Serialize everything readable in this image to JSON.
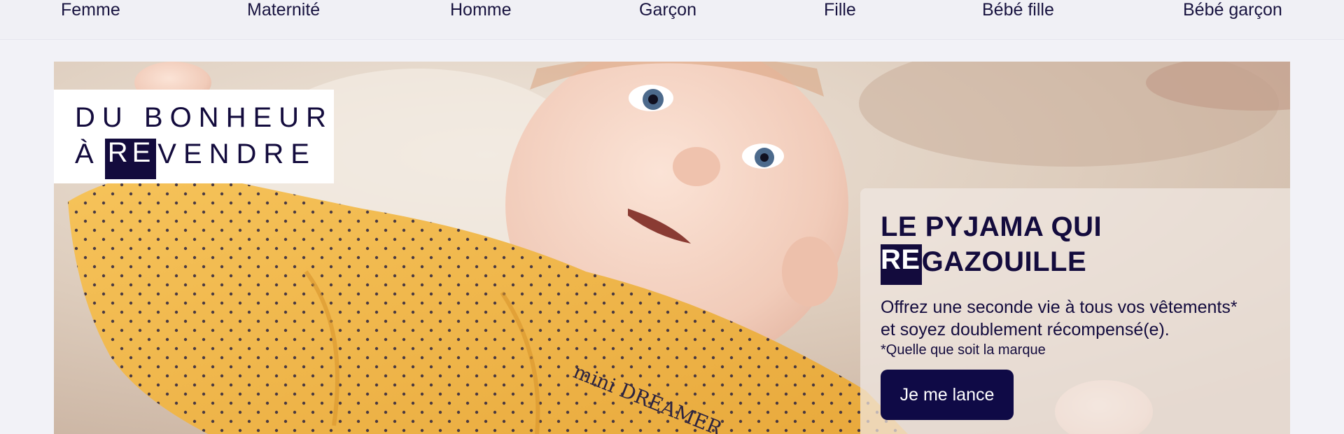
{
  "nav": {
    "items": [
      "Femme",
      "Maternité",
      "Homme",
      "Garçon",
      "Fille",
      "Bébé fille",
      "Bébé garçon"
    ]
  },
  "hero": {
    "logo": {
      "line1": "DU BONHEUR",
      "line2_prefix": "À",
      "line2_highlight": "RE",
      "line2_suffix": "VENDRE"
    },
    "promo": {
      "title_line1": "LE PYJAMA QUI",
      "title_highlight": "RE",
      "title_line2_rest": "GAZOUILLE",
      "description_line1": "Offrez une seconde vie à tous vos vêtements*",
      "description_line2": "et soyez doublement récompensé(e).",
      "footnote": "*Quelle que soit la marque",
      "cta_label": "Je me lance"
    },
    "image": {
      "garment_print": "mini DREAMER"
    }
  },
  "colors": {
    "brand_navy": "#130b3d",
    "cta_bg": "#0f0a46",
    "page_bg": "#f2f2f7",
    "pyjama_yellow": "#f2b84b"
  }
}
